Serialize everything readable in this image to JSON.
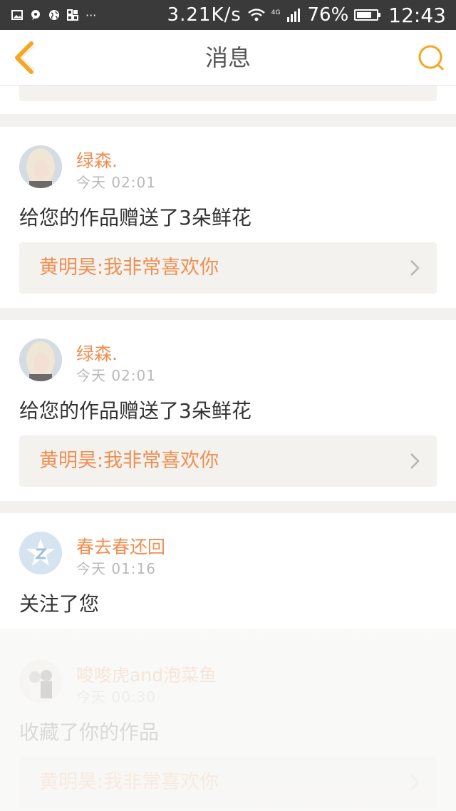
{
  "status_bar": {
    "speed": "3.21K/s",
    "network": "4G",
    "battery_percent": "76%",
    "battery_level": 0.76,
    "time": "12:43",
    "icons": [
      "picture-icon",
      "chat-icon",
      "globe-icon",
      "apps-icon",
      "more-icon",
      "wifi-icon",
      "signal-icon",
      "battery-icon"
    ]
  },
  "nav": {
    "title": "消息",
    "back_icon": "chevron-left-icon",
    "search_icon": "search-icon",
    "accent_color": "#f5a623"
  },
  "messages": [
    {
      "user": "绿森.",
      "time": "今天 02:01",
      "action": "给您的作品赠送了3朵鲜花",
      "reply": "黄明昊:我非常喜欢你",
      "avatar": "blonde-girl-avatar"
    },
    {
      "user": "绿森.",
      "time": "今天 02:01",
      "action": "给您的作品赠送了3朵鲜花",
      "reply": "黄明昊:我非常喜欢你",
      "avatar": "blonde-girl-avatar"
    },
    {
      "user": "春去春还回",
      "time": "今天 01:16",
      "action": "关注了您",
      "avatar": "default-star-avatar"
    },
    {
      "user": "唆唆虎and泡菜鱼",
      "time": "今天 00:30",
      "action": "收藏了你的作品",
      "reply": "黄明昊:我非常喜欢你",
      "avatar": "couple-photo-avatar"
    }
  ],
  "colors": {
    "name": "#ef8f52",
    "reply_bg": "#f3f2ee",
    "divider": "#f2f1ef"
  }
}
